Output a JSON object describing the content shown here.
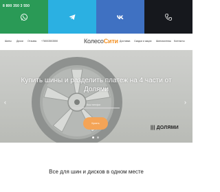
{
  "topbar": {
    "phone": "8 800 350 3 550",
    "items": [
      {
        "icon": "whatsapp-icon",
        "color": "#2a9a56"
      },
      {
        "icon": "telegram-icon",
        "color": "#2bb0e2"
      },
      {
        "icon": "vk-icon",
        "color": "#3f71c2"
      },
      {
        "icon": "phone-icon",
        "color": "#16181d"
      }
    ]
  },
  "nav": {
    "left": [
      "Шины",
      "Диски",
      "Отзывы",
      "+78003503550"
    ],
    "logo_part1": "Колесо",
    "logo_part2": "Сити",
    "right": [
      "Доставка",
      "Скидки и акции",
      "Шиномонтаж",
      "Контакты"
    ]
  },
  "hero": {
    "title": "Купить шины и разделить платеж на 4 части от Долями",
    "input_placeholder": "Ваш телефон",
    "button_label": "Купить",
    "badge": "||| ДОЛЯМИ",
    "prev_arrow": "‹",
    "next_arrow": "›"
  },
  "section": {
    "title": "Все для шин и дисков в одном месте"
  },
  "colors": {
    "accent": "#f4a457",
    "whatsapp": "#2a9a56",
    "telegram": "#2bb0e2",
    "vk": "#3f71c2",
    "phone": "#16181d"
  }
}
